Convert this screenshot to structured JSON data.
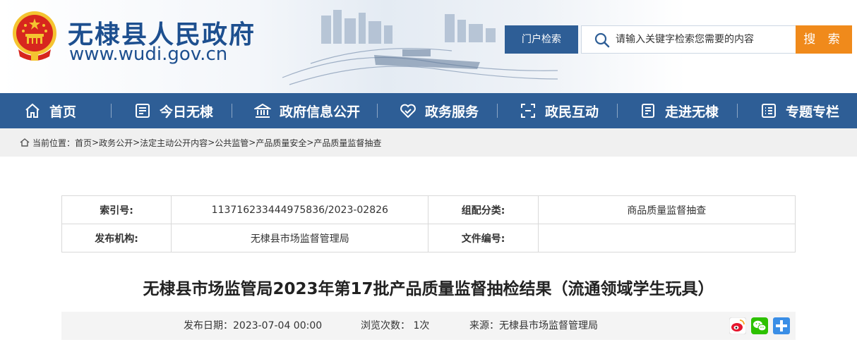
{
  "header": {
    "site_title": "无棣县人民政府",
    "site_url": "www.wudi.gov.cn",
    "search_scope": "门户检索",
    "search_placeholder": "请输入关键字检索您需要的内容",
    "search_button": "搜 索",
    "colors": {
      "brand": "#2e5e96",
      "title": "#1d4f8f",
      "search_button": "#f08a1b",
      "emblem_red": "#d7261e",
      "emblem_gold": "#f4c430"
    }
  },
  "nav": {
    "items": [
      {
        "label": "首页",
        "icon": "home-icon"
      },
      {
        "label": "今日无棣",
        "icon": "news-icon"
      },
      {
        "label": "政府信息公开",
        "icon": "building-icon"
      },
      {
        "label": "政务服务",
        "icon": "handshake-icon"
      },
      {
        "label": "政民互动",
        "icon": "interaction-icon"
      },
      {
        "label": "走进无棣",
        "icon": "book-icon"
      },
      {
        "label": "专题专栏",
        "icon": "list-icon"
      }
    ]
  },
  "breadcrumb": {
    "prefix": "当前位置：",
    "items": [
      "首页",
      "政务公开",
      "法定主动公开内容",
      "公共监管",
      "产品质量安全",
      "产品质量监督抽查"
    ],
    "separator": ">"
  },
  "info_table": {
    "rows": [
      {
        "k1": "索引号:",
        "v1": "113716233444975836/2023-02826",
        "k2": "组配分类:",
        "v2": "商品质量监督抽查"
      },
      {
        "k1": "发布机构:",
        "v1": "无棣县市场监督管理局",
        "k2": "文件编号:",
        "v2": ""
      }
    ]
  },
  "article": {
    "title": "无棣县市场监管局2023年第17批产品质量监督抽检结果（流通领域学生玩具）",
    "publish_date": "发布日期：2023-07-04 00:00",
    "views": "浏览次数： 1次",
    "source": "来源：无棣县市场监督管理局",
    "share_icons": [
      "weibo-icon",
      "wechat-icon",
      "more-share-icon"
    ]
  }
}
